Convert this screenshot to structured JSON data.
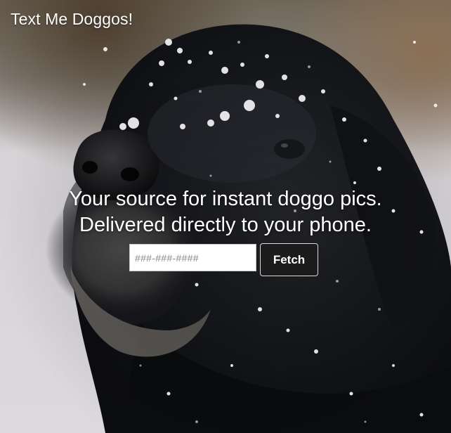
{
  "brand": {
    "title": "Text Me Doggos!"
  },
  "hero": {
    "image": "black-dog-in-snow",
    "headline_line1": "Your source for instant doggo pics.",
    "headline_line2": "Delivered directly to your phone."
  },
  "signup": {
    "phone_placeholder": "###-###-####",
    "phone_value": "",
    "fetch_label": "Fetch"
  },
  "colors": {
    "text": "#ffffff",
    "button_bg": "#1c1c1c",
    "input_bg": "#ffffff"
  }
}
